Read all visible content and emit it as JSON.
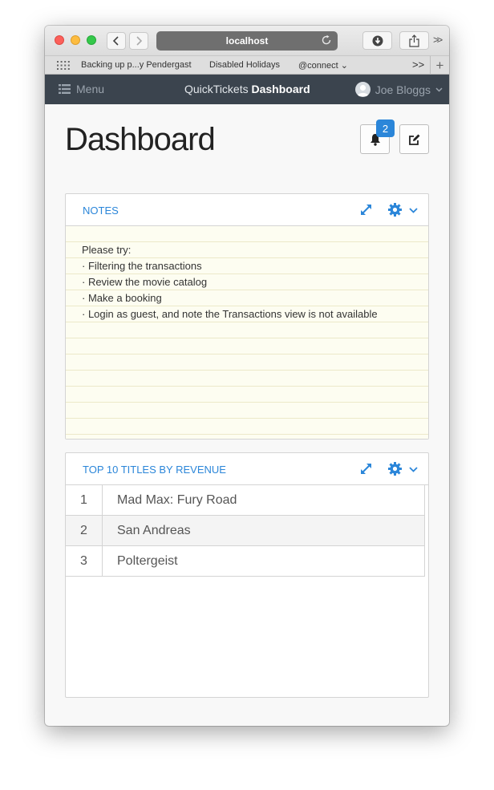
{
  "browser": {
    "url": "localhost",
    "bookmarks": [
      "Backing up p...y Pendergast",
      "Disabled Holidays",
      "@connect ⌄"
    ],
    "more_label": ">>"
  },
  "app": {
    "menu_label": "Menu",
    "brand_light": "QuickTickets",
    "brand_bold": "Dashboard",
    "user_name": "Joe Bloggs"
  },
  "page": {
    "title": "Dashboard",
    "notification_count": "2"
  },
  "notes": {
    "title": "NOTES",
    "lines": [
      "Please try:",
      "· Filtering the transactions",
      "· Review the movie catalog",
      "· Make a booking",
      "· Login as guest, and note the Transactions view is not available"
    ]
  },
  "top_titles": {
    "title": "TOP 10 TITLES BY REVENUE",
    "rows": [
      {
        "rank": "1",
        "title": "Mad Max: Fury Road"
      },
      {
        "rank": "2",
        "title": "San Andreas"
      },
      {
        "rank": "3",
        "title": "Poltergeist"
      }
    ]
  },
  "colors": {
    "accent": "#2b86d9",
    "navbar": "#3b444e"
  }
}
